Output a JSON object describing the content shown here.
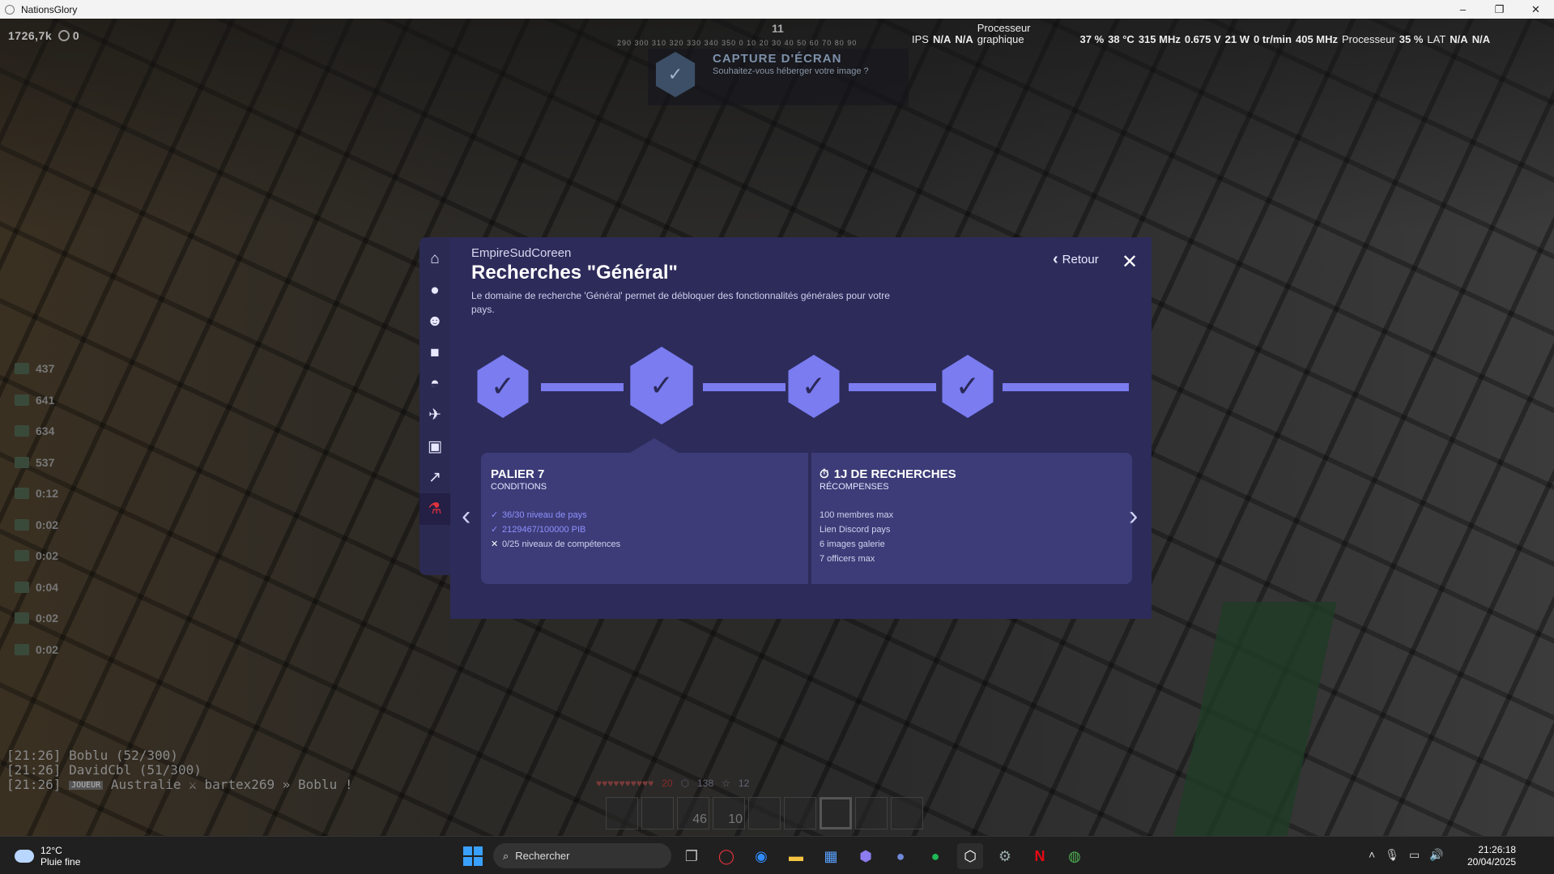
{
  "window": {
    "title": "NationsGlory",
    "minimize": "–",
    "maximize": "❐",
    "close": "✕"
  },
  "hud": {
    "money": "1726,7k",
    "money_suffix": "0",
    "compass_number": "11",
    "compass_scale": "290 300 310 320 330 340 350 0 10 20 30 40 50 60 70 80 90",
    "side_items": [
      "437",
      "641",
      "634",
      "537",
      "0:12",
      "0:02",
      "0:02",
      "0:04",
      "0:02",
      "0:02"
    ],
    "chat": [
      {
        "time": "[21:26]",
        "text": "Boblu (52/300)"
      },
      {
        "time": "[21:26]",
        "text": "DavidCbl (51/300)"
      },
      {
        "time": "[21:26]",
        "tag": "JOUEUR",
        "text": "Australie ⚔ bartex269 » Boblu !"
      }
    ],
    "hotbar_counts": [
      "",
      "",
      "46",
      "10",
      "",
      "",
      "",
      "",
      ""
    ],
    "xp_left": "20",
    "armor": "138",
    "level": "12"
  },
  "perf": {
    "ips_label": "IPS",
    "ips_value": "N/A",
    "ips_value2": "N/A",
    "gpu_label_1": "Processeur",
    "gpu_label_2": "graphique",
    "gpu_usage": "37 %",
    "gpu_temp": "38 °C",
    "gpu_clock": "315 MHz",
    "gpu_voltage": "0.675 V",
    "gpu_power": "21 W",
    "gpu_fan": "0 tr/min",
    "cpu_clock": "405 MHz",
    "cpu_label": "Processeur",
    "cpu_usage": "35 %",
    "lat_label": "LAT",
    "lat_value": "N/A",
    "lat_value2": "N/A"
  },
  "capture": {
    "title": "CAPTURE D'ÉCRAN",
    "subtitle": "Souhaitez-vous héberger votre image ?"
  },
  "modal": {
    "country": "EmpireSudCoreen",
    "title": "Recherches \"Général\"",
    "description": "Le domaine de recherche 'Général' permet de débloquer des fonctionnalités générales pour votre pays.",
    "back_label": "Retour",
    "close_label": "✕",
    "nav_icons": [
      "home-icon",
      "piggy-bank-icon",
      "users-icon",
      "briefcase-icon",
      "helmet-icon",
      "dove-icon",
      "gallery-icon",
      "chart-icon",
      "flask-icon"
    ],
    "progress_nodes": [
      {
        "state": "completed",
        "mark": "✓"
      },
      {
        "state": "completed",
        "mark": "✓",
        "selected": true
      },
      {
        "state": "completed",
        "mark": "✓"
      },
      {
        "state": "completed",
        "mark": "✓"
      }
    ],
    "tier": {
      "title": "PALIER 7",
      "conditions_label": "CONDITIONS",
      "conditions": [
        {
          "met": true,
          "mark": "✓",
          "text": "36/30 niveau de pays"
        },
        {
          "met": true,
          "mark": "✓",
          "text": "2129467/100000 PIB"
        },
        {
          "met": false,
          "mark": "✕",
          "text": "0/25 niveaux de compétences"
        }
      ],
      "duration_title": "1J DE RECHERCHES",
      "rewards_label": "RÉCOMPENSES",
      "rewards": [
        "100 membres max",
        "Lien Discord pays",
        "6 images galerie",
        "7 officers max"
      ]
    },
    "prev_arrow": "‹",
    "next_arrow": "›"
  },
  "taskbar": {
    "temperature": "12°C",
    "weather": "Pluie fine",
    "search_placeholder": "Rechercher",
    "time": "21:26:18",
    "date": "20/04/2025"
  }
}
